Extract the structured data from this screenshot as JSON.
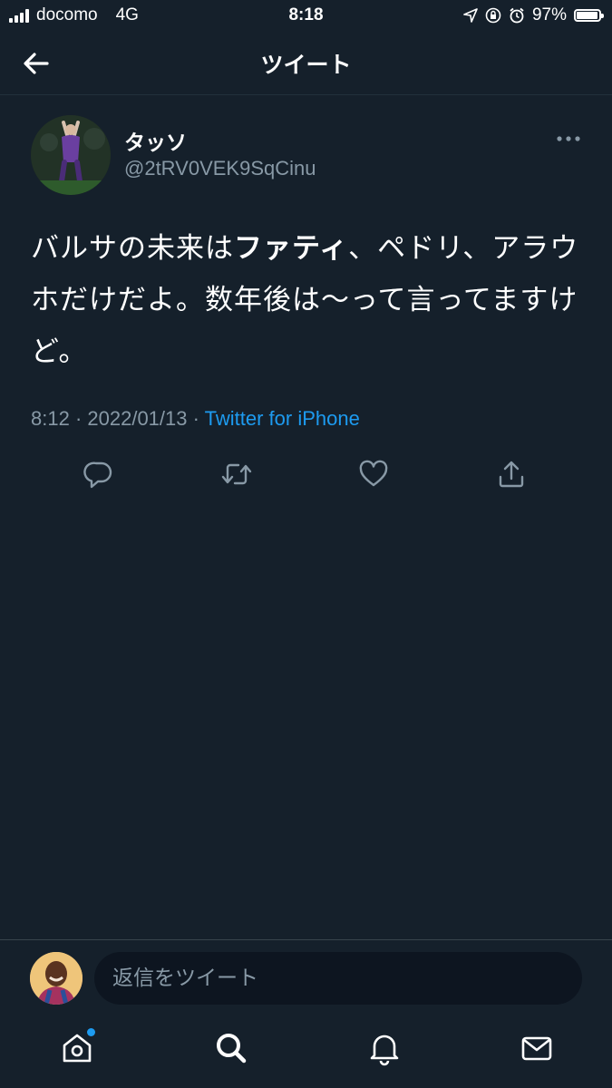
{
  "status_bar": {
    "carrier": "docomo",
    "network": "4G",
    "time": "8:18",
    "battery": "97%",
    "battery_level": 0.97
  },
  "header": {
    "title": "ツイート"
  },
  "tweet": {
    "author_name": "タッソ",
    "author_handle": "@2tRV0VEK9SqCinu",
    "text_before": "バルサの未来は",
    "text_bold": "ファティ",
    "text_after": "、ペドリ、アラウホだけだよ。数年後は〜って言ってますけど。",
    "time": "8:12",
    "separator": " · ",
    "date": "2022/01/13",
    "source": "Twitter for iPhone"
  },
  "actions": {
    "icons": [
      "reply-icon",
      "retweet-icon",
      "like-icon",
      "share-icon"
    ]
  },
  "reply": {
    "placeholder": "返信をツイート"
  },
  "tab_bar": {
    "icons": [
      "home-icon",
      "search-icon",
      "notifications-icon",
      "messages-icon"
    ]
  },
  "colors": {
    "background": "#15202b",
    "accent": "#1d9bf0",
    "secondary_text": "#8899a6"
  }
}
